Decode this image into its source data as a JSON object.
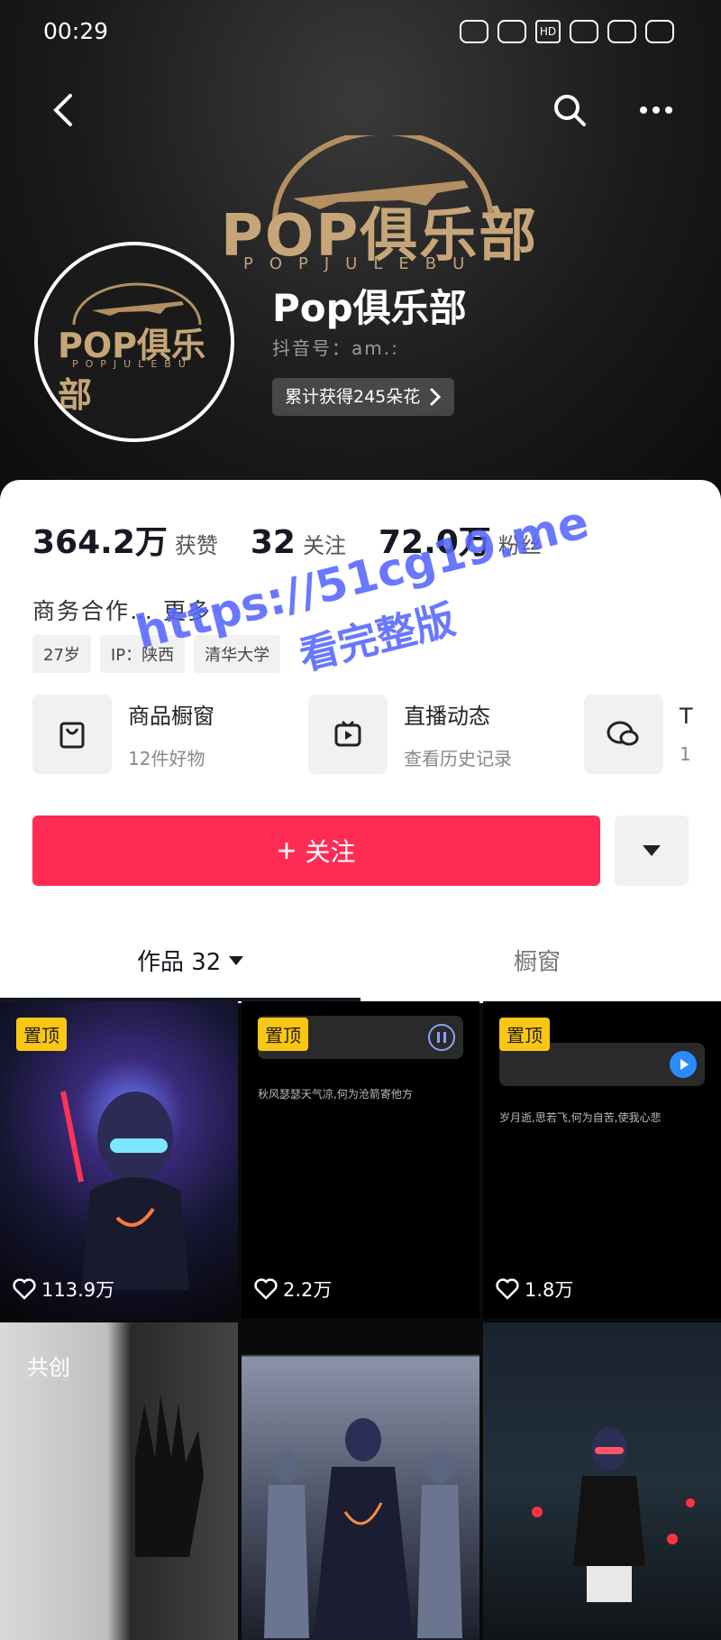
{
  "status_bar": {
    "time": "00:29",
    "hd": "HD"
  },
  "top_bar": {
    "back": "‹",
    "search": "search",
    "more": "more"
  },
  "banner": {
    "logo_text": "POP俱乐部",
    "logo_sub": "POPJULEBU"
  },
  "profile": {
    "avatar_text": "POP俱乐部",
    "avatar_sub": "POPJULEBU",
    "nickname": "Pop俱乐部",
    "douyin_id": "抖音号：am.:",
    "flowers": "累计获得245朵花"
  },
  "stats": [
    {
      "value": "364.2万",
      "label": "获赞"
    },
    {
      "value": "32",
      "label": "关注"
    },
    {
      "value": "72.0万",
      "label": "粉丝"
    }
  ],
  "bio": {
    "business": "商务合作…  更多"
  },
  "tags": [
    "27岁",
    "IP：陕西",
    "清华大学"
  ],
  "entries": [
    {
      "icon": "shopping-bag-icon",
      "title": "商品橱窗",
      "sub": "12件好物"
    },
    {
      "icon": "live-icon",
      "title": "直播动态",
      "sub": "查看历史记录"
    },
    {
      "icon": "chat-icon",
      "title": "T",
      "sub": "1"
    }
  ],
  "follow": {
    "label": "关注",
    "plus": "+"
  },
  "tabs": [
    {
      "label": "作品 32"
    },
    {
      "label": "橱窗"
    }
  ],
  "videos": [
    {
      "pinned": "置顶",
      "likes": "113.9万"
    },
    {
      "pinned": "置顶",
      "likes": "2.2万",
      "caption": "秋风瑟瑟天气凉,何为沧箭寄他方"
    },
    {
      "pinned": "置顶",
      "likes": "1.8万",
      "caption": "岁月逝,思若飞,何为自苦,使我心悲"
    },
    {
      "caption": "共创"
    },
    {},
    {}
  ],
  "watermark": {
    "line1": "https://51cg19.me",
    "line2": "看完整版"
  },
  "colors": {
    "accent": "#fe2c55",
    "pin": "#f9c714",
    "watermark": "#5566ff"
  }
}
